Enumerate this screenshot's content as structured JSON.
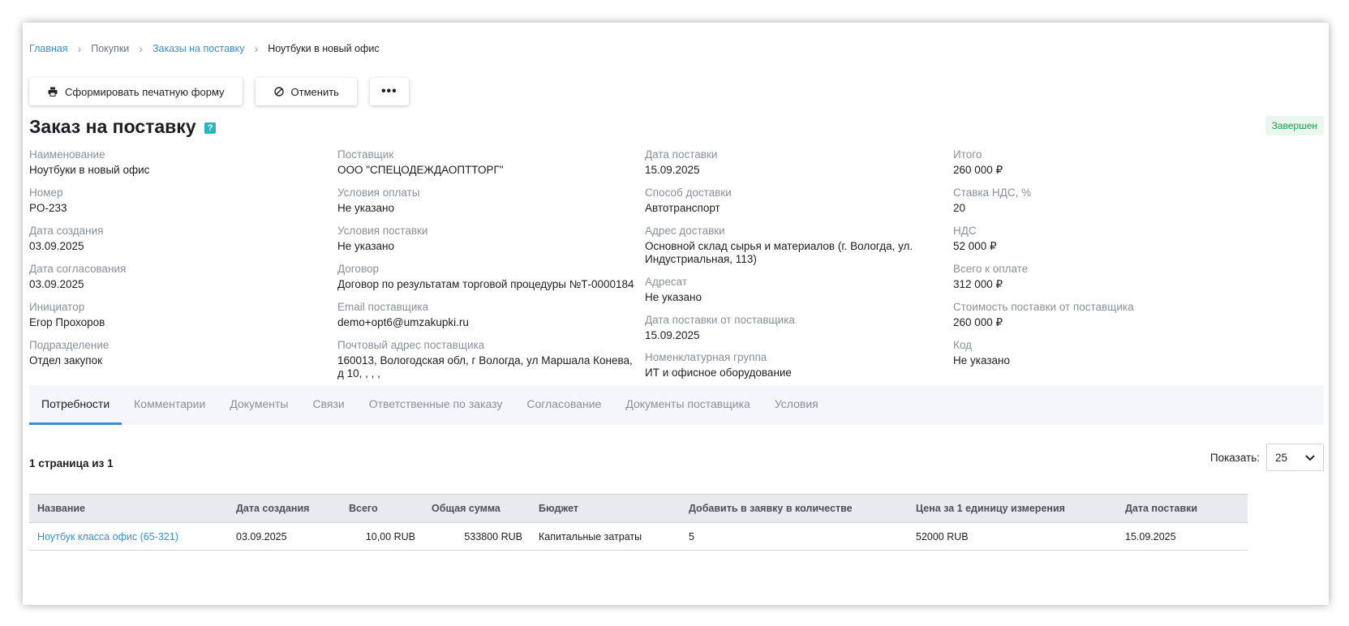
{
  "breadcrumb": [
    "Главная",
    "Покупки",
    "Заказы на поставку",
    "Ноутбуки в новый офис"
  ],
  "toolbar": {
    "print_label": "Сформировать печатную форму",
    "cancel_label": "Отменить",
    "more_label": "•••"
  },
  "title": "Заказ на поставку",
  "help": "?",
  "status": "Завершен",
  "fields": {
    "col1": [
      {
        "label": "Наименование",
        "value": "Ноутбуки в новый офис"
      },
      {
        "label": "Номер",
        "value": "PO-233"
      },
      {
        "label": "Дата создания",
        "value": "03.09.2025"
      },
      {
        "label": "Дата согласования",
        "value": "03.09.2025"
      },
      {
        "label": "Инициатор",
        "value": "Егор Прохоров"
      },
      {
        "label": "Подразделение",
        "value": "Отдел закупок"
      }
    ],
    "col2": [
      {
        "label": "Поставщик",
        "value": "ООО \"СПЕЦОДЕЖДАОПТТОРГ\""
      },
      {
        "label": "Условия оплаты",
        "value": "Не указано"
      },
      {
        "label": "Условия поставки",
        "value": "Не указано"
      },
      {
        "label": "Договор",
        "value": "Договор по результатам торговой процедуры №Т-0000184"
      },
      {
        "label": "Email поставщика",
        "value": "demo+opt6@umzakupki.ru"
      },
      {
        "label": "Почтовый адрес поставщика",
        "value": "160013, Вологодская обл, г Вологда, ул Маршала Конева, д 10, , , ,"
      }
    ],
    "col3": [
      {
        "label": "Дата поставки",
        "value": "15.09.2025"
      },
      {
        "label": "Способ доставки",
        "value": "Автотранспорт"
      },
      {
        "label": "Адрес доставки",
        "value": "Основной склад сырья и материалов (г. Вологда, ул. Индустриальная, 113)"
      },
      {
        "label": "Адресат",
        "value": "Не указано"
      },
      {
        "label": "Дата поставки от поставщика",
        "value": "15.09.2025"
      },
      {
        "label": "Номенклатурная группа",
        "value": "ИТ и офисное оборудование"
      }
    ],
    "col4": [
      {
        "label": "Итого",
        "value": "260 000 ₽"
      },
      {
        "label": "Ставка НДС, %",
        "value": "20"
      },
      {
        "label": "НДС",
        "value": "52 000 ₽"
      },
      {
        "label": "Всего к оплате",
        "value": "312 000 ₽"
      },
      {
        "label": "Стоимость поставки от поставщика",
        "value": "260 000 ₽"
      },
      {
        "label": "Код",
        "value": "Не указано"
      }
    ]
  },
  "tabs": [
    "Потребности",
    "Комментарии",
    "Документы",
    "Связи",
    "Ответственные по заказу",
    "Согласование",
    "Документы поставщика",
    "Условия"
  ],
  "pager": {
    "info": "1 страница из 1",
    "show_label": "Показать:",
    "page_size": "25"
  },
  "table": {
    "headers": [
      "Название",
      "Дата создания",
      "Всего",
      "Общая сумма",
      "Бюджет",
      "Добавить в заявку в количестве",
      "Цена за 1 единицу измерения",
      "Дата поставки"
    ],
    "rows": [
      [
        "Ноутбук класса офис (65-321)",
        "03.09.2025",
        "10,00 RUB",
        "533800 RUB",
        "Капитальные затраты",
        "5",
        "52000 RUB",
        "15.09.2025"
      ]
    ]
  }
}
